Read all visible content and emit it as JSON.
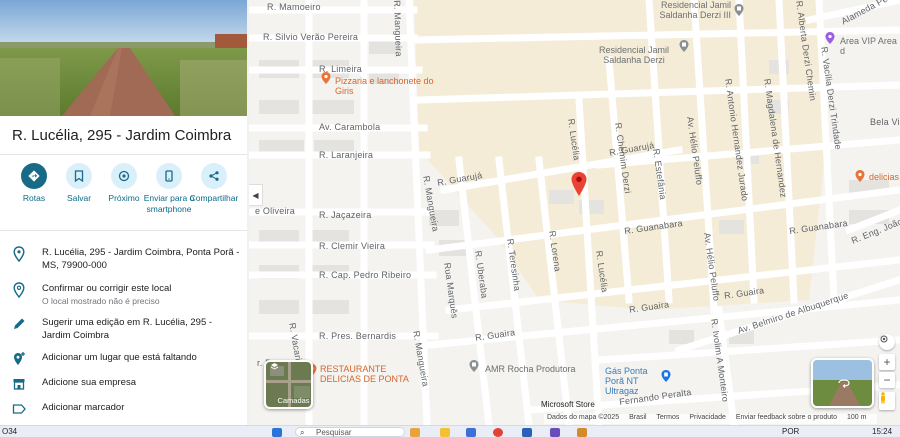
{
  "place": {
    "title": "R. Lucélia, 295 - Jardim Coimbra"
  },
  "actions": [
    {
      "label": "Rotas",
      "icon": "directions-icon"
    },
    {
      "label": "Salvar",
      "icon": "bookmark-icon"
    },
    {
      "label": "Próximo",
      "icon": "nearby-icon"
    },
    {
      "label": "Enviar para o smartphone",
      "icon": "send-to-phone-icon"
    },
    {
      "label": "Compartilhar",
      "icon": "share-icon"
    }
  ],
  "info": {
    "address": "R. Lucélia, 295 - Jardim Coimbra, Ponta Porã - MS, 79900-000",
    "confirm_title": "Confirmar ou corrigir este local",
    "confirm_sub": "O local mostrado não é preciso",
    "suggest_edit": "Sugerir uma edição em R. Lucélia, 295 - Jardim Coimbra",
    "add_place": "Adicionar um lugar que está faltando",
    "add_business": "Adicione sua empresa",
    "add_label": "Adicionar marcador"
  },
  "map": {
    "streets": {
      "mamoeiro": "R. Mamoeiro",
      "silvio": "R. Silvio Verão Pereira",
      "limeira": "R. Limeira",
      "carambola": "Av. Carambola",
      "laranjeira": "R. Laranjeira",
      "oliveira": "e Oliveira",
      "jacazeira": "R. Jaçazeira",
      "clemir": "R. Clemir Vieira",
      "cap_pedro": "R. Cap. Pedro Ribeiro",
      "pres_bernardis": "R. Pres. Bernardis",
      "mangueira_top": "R. Mangueira",
      "mangueira_mid": "R. Mangueira",
      "mangueira_bot": "R. Mangueira",
      "guaruja_left": "R. Guarujá",
      "guaruja_right": "R. Guarujá",
      "guanabara_mid": "R. Guanabara",
      "guanabara_right": "R. Guanabara",
      "guaira_left": "R. Guaira",
      "guaira_mid": "R. Guaira",
      "guaira_right": "R. Guaira",
      "belmiro": "Av. Belmiro de Albuquerque",
      "lucelia_top": "R. Lucélia",
      "lucelia_bot": "R. Lucélia",
      "lorena": "R. Lorena",
      "teresina": "R. Teresinha",
      "uberaba": "R. Uberaba",
      "rua_marques": "Rua Marquês",
      "chemim": "R. Chemim Derzi",
      "estefania": "R. Estefânia",
      "helio_top": "Av. Hélio Peluffo",
      "helio_bot": "Av. Hélio Peluffo",
      "antonio": "R. Antonio Hernandez Jurado",
      "magdalena": "R. Magdalena de Hernandez",
      "vacilia": "R. Vacília Derzi Trindade",
      "alberta": "R. Alberta Derzi Chemin",
      "ivolim": "R. Ivolim A Monteiro",
      "fernando": "Fernando Peralta",
      "alameda": "Alameda Pe",
      "eng_joao": "R. Eng. João Albe",
      "vacaria": "R. Vacaria",
      "bela_vis": "Bela Vis",
      "b_left": "r. B"
    },
    "pois": {
      "pizzaria": "Pizzaria e lanchonete do Giris",
      "residencial_top": "Residencial Jamil Saldanha Derzi III",
      "residencial_mid": "Residencial Jamil Saldanha Derzi",
      "area_vip": "Area VIP Area d",
      "restaurante": "RESTAURANTE DELICIAS DE PONTA",
      "amr": "AMR Rocha Produtora",
      "gas": "Gás Ponta Porã NT Ultragaz",
      "delicias": "delicias"
    },
    "layers_label": "Camadas",
    "ms_store": "Microsoft Store",
    "attribution": [
      "Dados do mapa ©2025",
      "Brasil",
      "Termos",
      "Privacidade",
      "Enviar feedback sobre o produto",
      "100 m"
    ]
  },
  "taskbar": {
    "left_text": "O34",
    "search_placeholder": "Pesquisar",
    "lang": "POR",
    "time": "15:24"
  },
  "colors": {
    "accent": "#176b87",
    "pin": "#ea4335",
    "map_bg": "#f4f3f0",
    "road": "#ffffff",
    "poi_orange": "#d7652b"
  }
}
